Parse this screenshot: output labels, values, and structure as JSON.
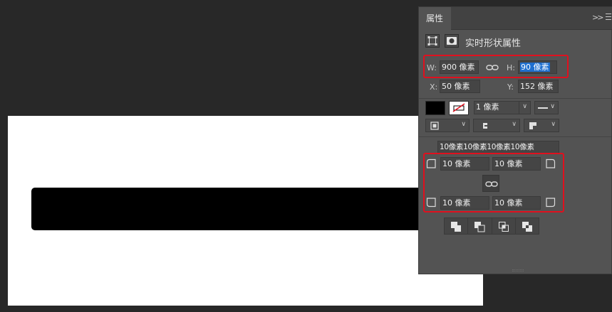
{
  "document": {
    "shape_fill": "#000000",
    "canvas_bg": "#ffffff"
  },
  "panel": {
    "tab_label": "属性",
    "collapse_icon": "double-chevron-right-icon",
    "menu_icon": "panel-menu-icon",
    "header": {
      "title": "实时形状属性"
    },
    "size": {
      "w_label": "W:",
      "w_value": "900 像素",
      "h_label": "H:",
      "h_value": "90 像素"
    },
    "position": {
      "x_label": "X:",
      "x_value": "50 像素",
      "y_label": "Y:",
      "y_value": "152 像素"
    },
    "stroke": {
      "fill_color": "#000000",
      "stroke_width": "1 像素"
    },
    "corners": {
      "summary": "10像素10像素10像素10像素",
      "top_left": "10 像素",
      "top_right": "10 像素",
      "bottom_left": "10 像素",
      "bottom_right": "10 像素"
    }
  }
}
